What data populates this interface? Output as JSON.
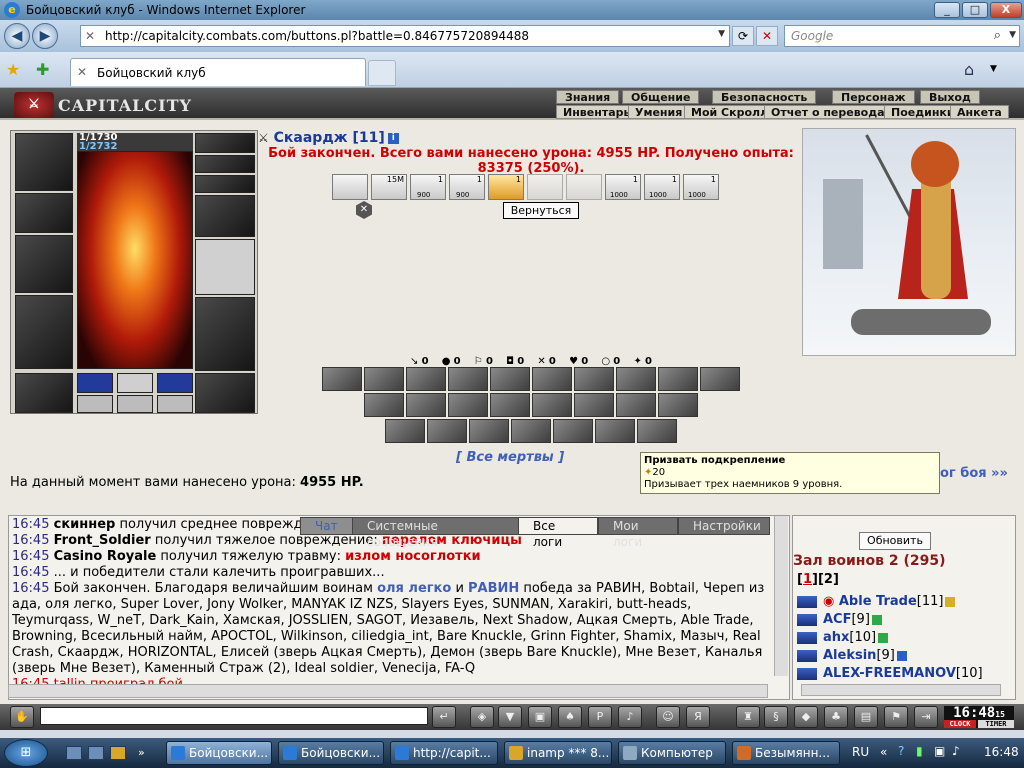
{
  "window": {
    "title": "Бойцовский клуб - Windows Internet Explorer",
    "min": "_",
    "max": "□",
    "close": "X"
  },
  "address": {
    "url": "http://capitalcity.combats.com/buttons.pl?battle=0.846775720894488",
    "search_placeholder": "Google"
  },
  "tab": {
    "label": "Бойцовский клуб"
  },
  "game_menu": {
    "brand": "CAPITALCITY",
    "top": [
      "Знания",
      "Общение",
      "Безопасность",
      "Персонаж",
      "Выход"
    ],
    "sub": [
      "Инвентарь",
      "Умения",
      "Мой Скролл",
      "Отчет о переводах",
      "Поединки",
      "Анкета"
    ]
  },
  "character": {
    "hp": "1/1730",
    "mp": "1/2732",
    "name_line": "Скаардж [11]"
  },
  "battle": {
    "result": "Бой закончен. Всего вами нанесено урона: 4955 HP. Получено опыта: 83375 (250%).",
    "return_label": "Вернуться",
    "all_dead": "[ Все мертвы ]",
    "damage_prefix": "На данный момент вами нанесено урона: ",
    "damage_value": "4955 HP.",
    "end_link": "ог боя »»",
    "ability_counts": [
      "",
      "15M",
      "1",
      "1",
      "1",
      "",
      "",
      "1",
      "1",
      "1"
    ],
    "ability_sublabels": [
      "",
      "",
      "900",
      "900",
      "",
      "",
      "",
      "1000",
      "1000",
      "1000"
    ],
    "stats": [
      "0",
      "0",
      "0",
      "0",
      "0",
      "0",
      "0",
      "0"
    ]
  },
  "tooltip": {
    "title": "Призвать подкрепление",
    "cost": "20",
    "desc": "Призывает трех наемников 9 уровня."
  },
  "chat_tabs": [
    "Чат",
    "Системные сообщения",
    "Все логи",
    "Мои логи",
    "Настройки"
  ],
  "chat": {
    "l1_time": "16:45",
    "l1_nick": "скиннер",
    "l1_text": " получил среднее поврежд",
    "l2_time": "16:45",
    "l2_nick": "Front_Soldier",
    "l2_text": " получил тяжелое повреждение: ",
    "l2_red": "перелом ключицы",
    "l3_time": "16:45",
    "l3_nick": "Casino Royale",
    "l3_text": " получил тяжелую травму: ",
    "l3_red": "излом носоглотки",
    "l4_time": "16:45",
    "l4_text": " ... и победители стали калечить проигравших...",
    "l5_time": "16:45",
    "l5_a": " Бой закончен. Благодаря величайшим воинам ",
    "l5_b1": "оля легко",
    "l5_and": " и ",
    "l5_b2": "РАВИН",
    "l5_c": " победа за РАВИН, Bobtail, Череп из ада, оля легко, Super Lover, Jony Wolker, MANYAK IZ NZS, Slayers Eyes, SUNMAN, Xarakiri, butt-heads, Teymurqass, W_neT, Dark_Kain, Хамская, JOSSLIEN, SAGOT, Иезавель, Next Shadow, Ацкая Смерть, Able Trade, Browning, Всесильный найм, APOCTOL, Wilkinson, ciliedgia_int, Bare Knuckle, Grinn Fighter, Shamix, Мазыч, Real Crash, Скаардж, HORIZONTAL, Елисей (зверь Ацкая Смерть), Демон (зверь Bare Knuckle), Мне Везет, Каналья (зверь Мне Везет), Каменный Страж (2), Ideal soldier, Venecija, FA-Q",
    "l6_time": "16:45",
    "l6_text": " tallin проиграл бой..."
  },
  "room": {
    "refresh": "Обновить",
    "title": "Зал воинов 2 (295)",
    "page1": "1",
    "page2": "2",
    "players": [
      {
        "name": "Able Trade",
        "level": "[11]"
      },
      {
        "name": "ACF",
        "level": "[9]"
      },
      {
        "name": "ahx",
        "level": "[10]"
      },
      {
        "name": "Aleksin",
        "level": "[9]"
      },
      {
        "name": "ALEX-FREEMANOV",
        "level": "[10]"
      }
    ]
  },
  "clock": {
    "time": "16:48",
    "sec": "15",
    "clock_lbl": "CLOCK",
    "timer_lbl": "TIMER"
  },
  "taskbar": {
    "tasks": [
      "Бойцовски...",
      "Бойцовски...",
      "http://capit...",
      "inamp *** 8...",
      "Компьютер",
      "Безымянн..."
    ],
    "lang": "RU",
    "time": "16:48"
  },
  "colors": {
    "accent_red": "#d00000",
    "link_blue": "#3f5fb8",
    "nick_blue": "#1a3a9a"
  }
}
